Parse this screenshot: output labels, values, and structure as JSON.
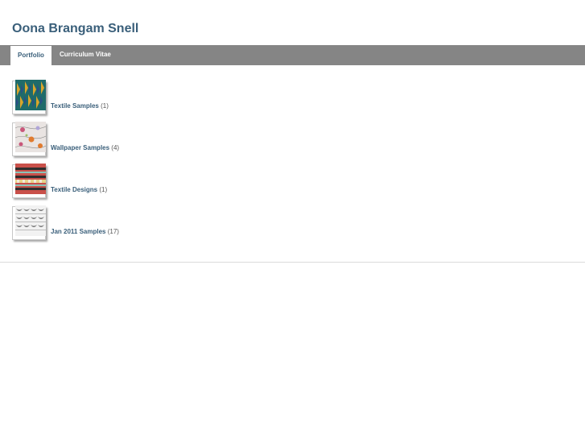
{
  "site": {
    "title": "Oona Brangam Snell"
  },
  "nav": {
    "tabs": [
      {
        "label": "Portfolio",
        "active": true
      },
      {
        "label": "Curriculum Vitae",
        "active": false
      }
    ]
  },
  "galleries": [
    {
      "name": "Textile Samples",
      "count": "(1)",
      "thumb_colors": [
        "#1f6b6a",
        "#d9a52b",
        "#2a4f86"
      ]
    },
    {
      "name": "Wallpaper Samples",
      "count": "(4)",
      "thumb_colors": [
        "#e9e4e2",
        "#c9577a",
        "#e07b2f"
      ]
    },
    {
      "name": "Textile Designs",
      "count": "(1)",
      "thumb_colors": [
        "#c9504a",
        "#2e2e2e",
        "#8ac2b8"
      ]
    },
    {
      "name": "Jan 2011 Samples",
      "count": "(17)",
      "thumb_colors": [
        "#f2f2f2",
        "#7a7a7a",
        "#bdbdbd"
      ]
    }
  ]
}
